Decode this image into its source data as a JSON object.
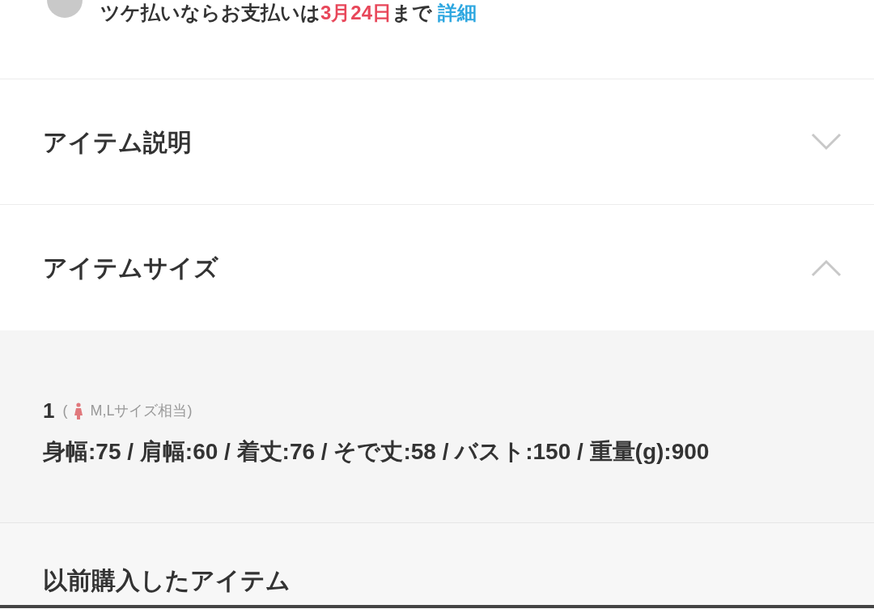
{
  "payment_note": {
    "prefix": "ツケ払いならお支払いは",
    "date": "3月24日",
    "suffix": "まで",
    "link": "詳細"
  },
  "sections": [
    {
      "title": "アイテム説明",
      "expanded": false
    },
    {
      "title": "アイテムサイズ",
      "expanded": true,
      "sizes": [
        {
          "label": "1",
          "paren": "(",
          "equivalent": "M,Lサイズ相当)",
          "measurements": "身幅:75 / 肩幅:60 / 着丈:76 / そで丈:58 / バスト:150 / 重量(g):900"
        }
      ]
    }
  ],
  "previous_items": {
    "title": "以前購入したアイテム"
  }
}
